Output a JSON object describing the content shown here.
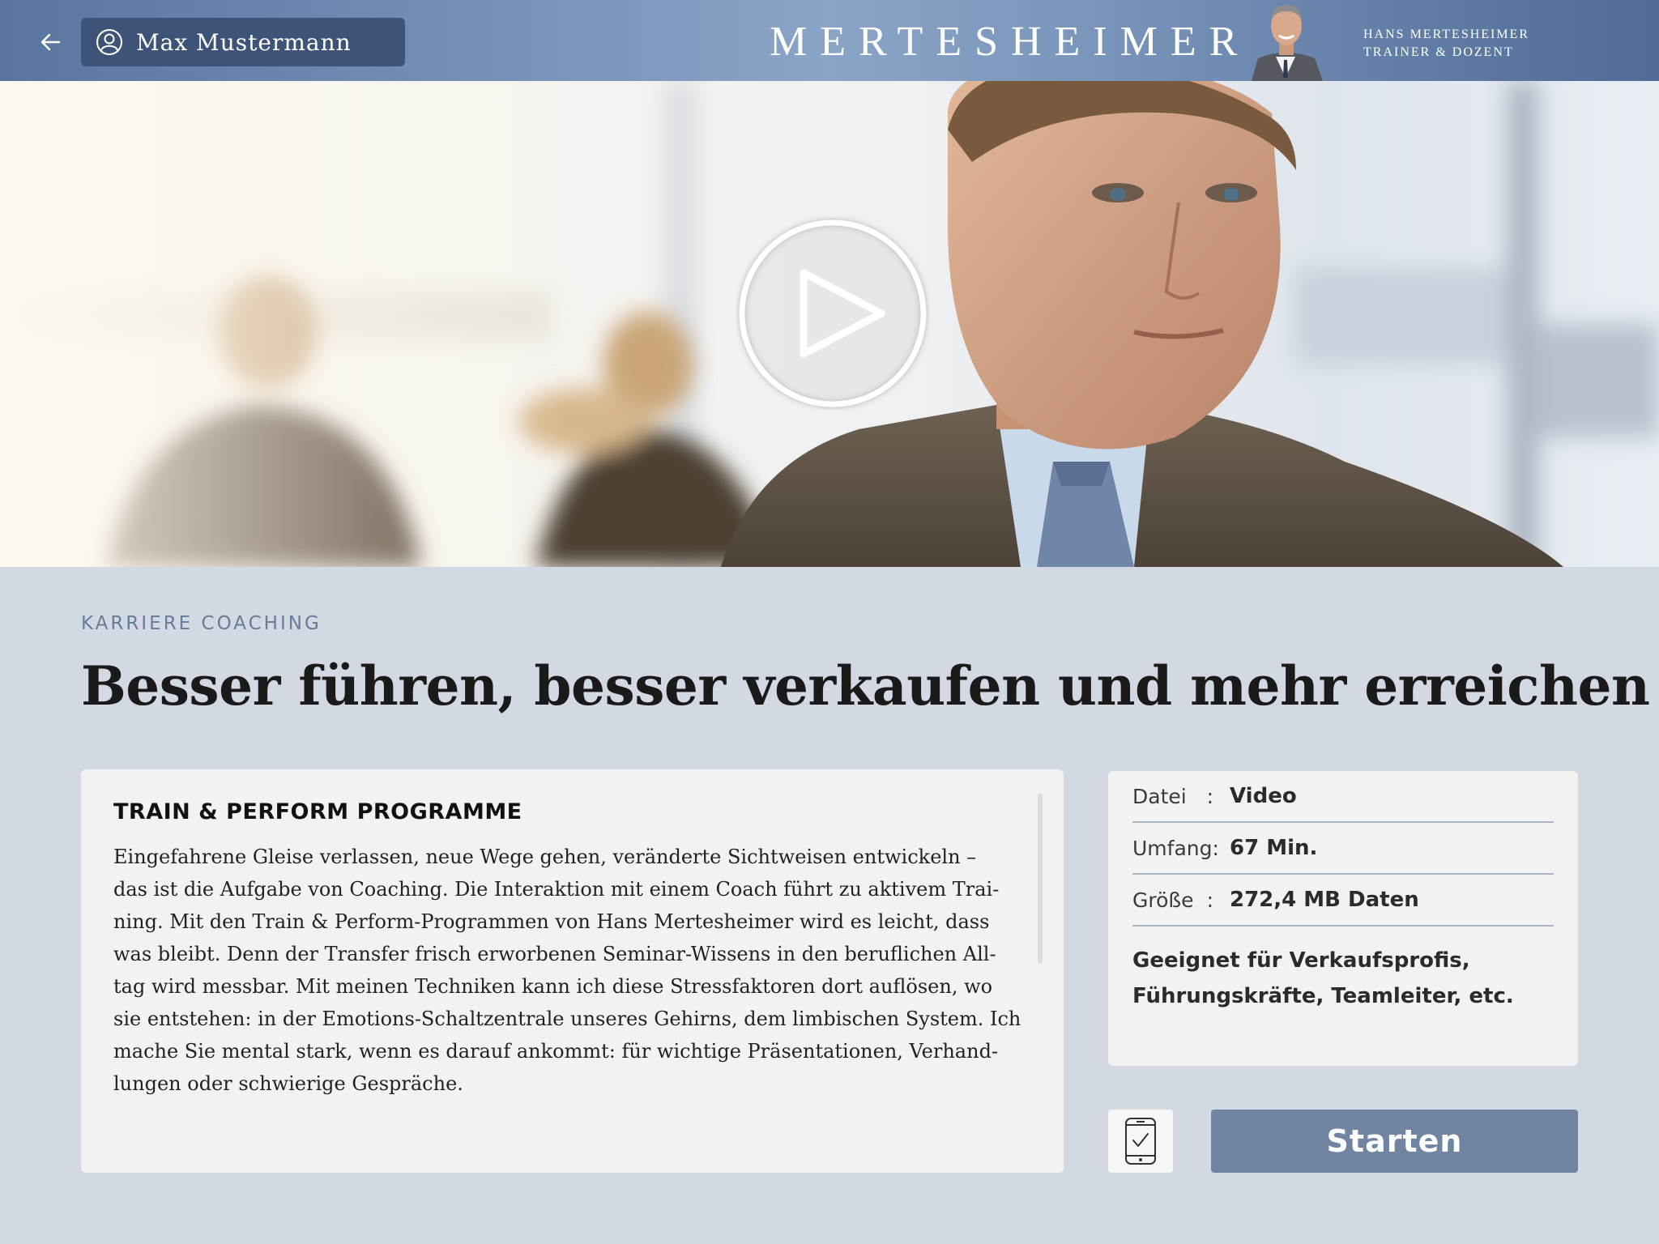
{
  "header": {
    "user_name": "Max Mustermann",
    "brand": "MERTESHEIMER",
    "trainer_name": "HANS MERTESHEIMER",
    "trainer_role": "TRAINER & DOZENT",
    "icons": [
      "back-arrow-icon",
      "user-icon"
    ]
  },
  "hero": {
    "play_icon": "play-icon"
  },
  "content": {
    "category": "KARRIERE COACHING",
    "title": "Besser führen, besser verkaufen und mehr erreichen",
    "description": {
      "heading": "TRAIN & PERFORM PROGRAMME",
      "lines": [
        "Eingefahrene Gleise verlassen, neue Wege gehen, veränderte Sichtweisen entwickeln –",
        "das ist die Aufgabe von Coaching. Die Interaktion mit einem Coach führt zu aktivem Trai-",
        "ning. Mit den Train & Perform-Programmen von Hans Mertesheimer wird es leicht, dass",
        "was bleibt. Denn der Transfer frisch erworbenen Seminar-Wissens in den beruflichen All-",
        "tag wird messbar. Mit meinen Techniken kann ich diese Stressfaktoren dort auflösen, wo",
        "sie entstehen: in der Emotions-Schaltzentrale unseres Gehirns, dem limbischen System. Ich",
        "mache Sie mental stark, wenn es darauf ankommt: für wichtige  Präsentationen, Verhand-",
        "lungen oder schwierige Gespräche."
      ]
    },
    "info": {
      "rows": [
        {
          "key": "Datei",
          "value": "Video"
        },
        {
          "key": "Umfang",
          "value": "67 Min."
        },
        {
          "key": "Größe",
          "value": "272,4 MB Daten"
        }
      ],
      "separator": ":",
      "suitable_line1": "Geeignet für Verkaufsprofis,",
      "suitable_line2": "Führungskräfte, Teamleiter, etc."
    },
    "actions": {
      "device_icon": "smartphone-check-icon",
      "start_label": "Starten"
    }
  },
  "colors": {
    "header_bg": "#7a96bb",
    "user_pill": "#3d5478",
    "page_bg": "#d3d9e2",
    "card_bg": "#f2f2f3",
    "accent": "#7184a1",
    "category_text": "#687b96"
  }
}
